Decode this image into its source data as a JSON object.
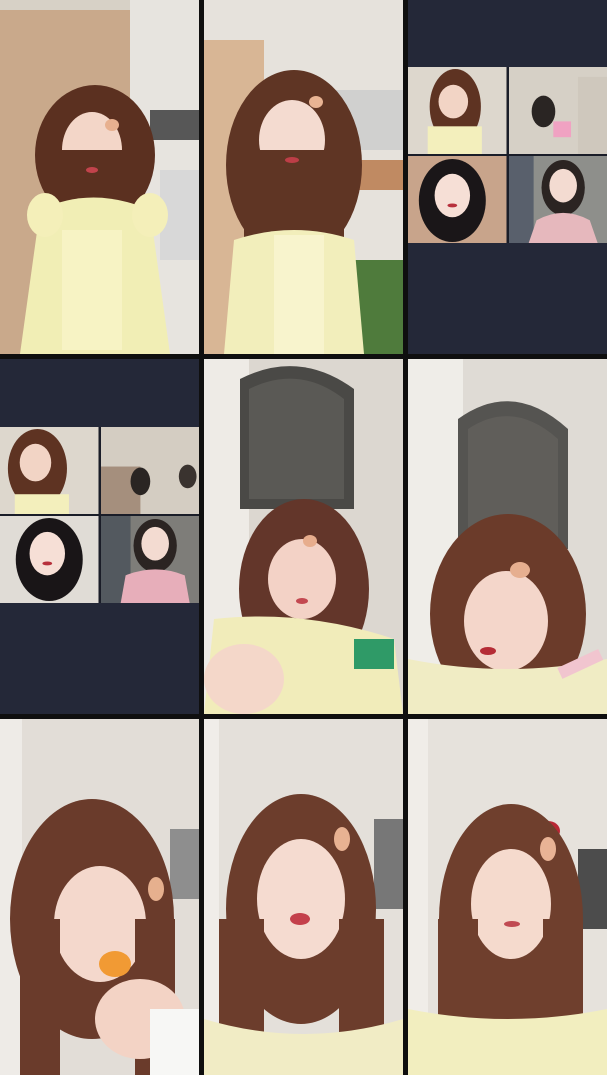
{
  "collage": {
    "columns": 3,
    "rows": 3,
    "background": "#111111"
  },
  "colors": {
    "panel_dark": "#242838",
    "hair_brown": "#6b3b27",
    "skin": "#f4d8cb",
    "dress_yellow": "#f3efb4",
    "wall": "#dcd8d2",
    "mirror_dark": "#4a4a48",
    "lips_red": "#b8323f"
  },
  "tiles": [
    {
      "id": "kitchen-portrait-1",
      "scene": "kitchen",
      "panel": "single"
    },
    {
      "id": "kitchen-portrait-2",
      "scene": "kitchen",
      "panel": "single"
    },
    {
      "id": "group-call-grid-1",
      "scene": "video-call-grid",
      "panel": "quad"
    },
    {
      "id": "group-call-grid-2",
      "scene": "video-call-grid",
      "panel": "quad"
    },
    {
      "id": "mirror-room-portrait-1",
      "scene": "round-mirror",
      "panel": "single"
    },
    {
      "id": "mirror-room-portrait-2",
      "scene": "round-mirror",
      "panel": "single"
    },
    {
      "id": "closeup-eating",
      "scene": "bedroom-closeup",
      "panel": "single"
    },
    {
      "id": "closeup-pout",
      "scene": "bedroom-closeup",
      "panel": "single"
    },
    {
      "id": "closeup-glance",
      "scene": "bedroom-closeup",
      "panel": "single"
    }
  ]
}
